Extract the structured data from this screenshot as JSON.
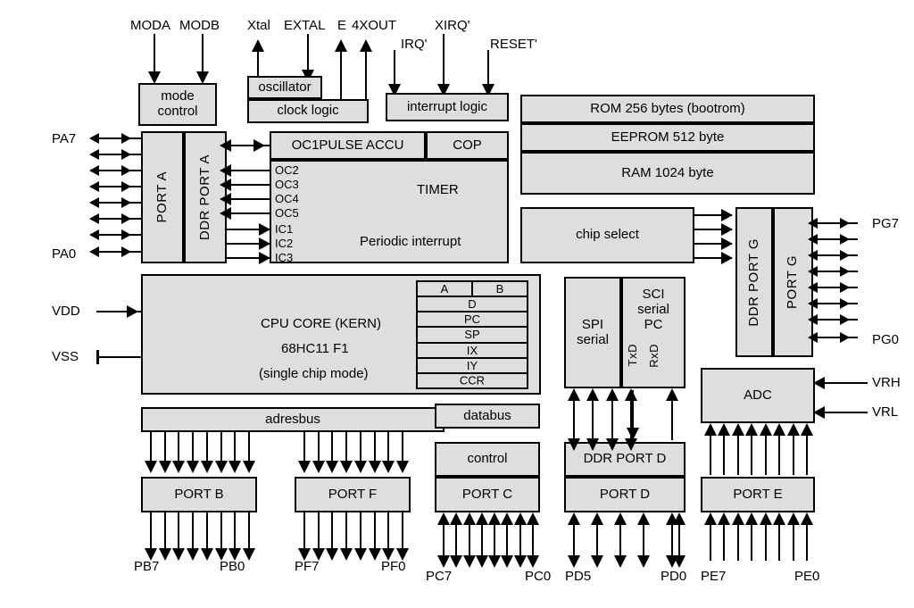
{
  "diagram": {
    "title": "68HC11 F1 microcontroller block diagram",
    "fill_color": "#dedede",
    "line_color": "#000000"
  },
  "top_pins": {
    "moda": "MODA",
    "modb": "MODB",
    "xtal": "Xtal",
    "extal": "EXTAL",
    "e": "E",
    "x4out": "4XOUT",
    "irq": "IRQ'",
    "xirq": "XIRQ'",
    "reset": "RESET'"
  },
  "left_pins": {
    "pa7": "PA7",
    "pa0": "PA0",
    "vdd": "VDD",
    "vss": "VSS"
  },
  "right_pins": {
    "pg7": "PG7",
    "pg0": "PG0",
    "vrh": "VRH",
    "vrl": "VRL"
  },
  "bottom_pins": {
    "pb7": "PB7",
    "pb0": "PB0",
    "pf7": "PF7",
    "pf0": "PF0",
    "pc7": "PC7",
    "pc0": "PC0",
    "pd5": "PD5",
    "pd0": "PD0",
    "pe7": "PE7",
    "pe0": "PE0"
  },
  "blocks": {
    "mode_control": "mode\ncontrol",
    "oscillator": "oscillator",
    "clock_logic": "clock logic",
    "interrupt_logic": "interrupt logic",
    "rom": "ROM   256 bytes (bootrom)",
    "eeprom": "EEPROM 512 byte",
    "ram": "RAM 1024 byte",
    "chip_select": "chip select",
    "port_a": "PORT A",
    "ddr_port_a": "DDR PORT A",
    "oc1pulse_accu": "OC1PULSE ACCU",
    "cop": "COP",
    "timer": "TIMER",
    "periodic_interrupt": "Periodic interrupt",
    "ddr_port_g": "DDR PORT G",
    "port_g": "PORT G",
    "cpu_core_line1": "CPU CORE (KERN)",
    "cpu_core_line2": "68HC11 F1",
    "cpu_core_line3": "(single chip mode)",
    "spi": "SPI\nserial",
    "sci": "SCI\nserial\nPC",
    "txd": "TxD",
    "rxd": "RxD",
    "adc": "ADC",
    "adresbus": "adresbus",
    "databus": "databus",
    "control": "control",
    "ddr_port_d": "DDR PORT D",
    "port_b": "PORT B",
    "port_f": "PORT F",
    "port_c": "PORT C",
    "port_d": "PORT D",
    "port_e": "PORT E"
  },
  "timer_channels": {
    "oc2": "OC2",
    "oc3": "OC3",
    "oc4": "OC4",
    "oc5": "OC5",
    "ic1": "IC1",
    "ic2": "IC2",
    "ic3": "IC3"
  },
  "cpu_registers": {
    "a": "A",
    "b": "B",
    "d": "D",
    "pc": "PC",
    "sp": "SP",
    "ix": "IX",
    "iy": "IY",
    "ccr": "CCR"
  }
}
